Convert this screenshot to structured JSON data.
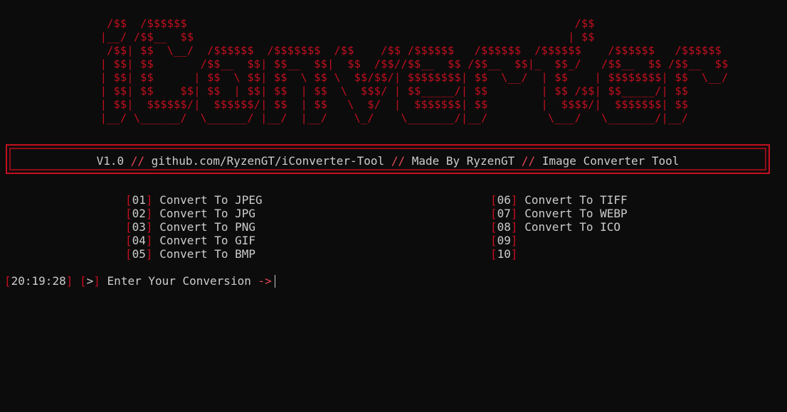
{
  "banner": {
    "lines": [
      "                /$$  /$$$$$$                                                          /$$",
      "               |__/ /$$__  $$                                                        | $$",
      "                /$$| $$  \\__/  /$$$$$$  /$$$$$$$  /$$    /$$ /$$$$$$   /$$$$$$  /$$$$$$    /$$$$$$   /$$$$$$",
      "               | $$| $$       /$$__  $$| $$__  $$|  $$  /$$//$$__  $$ /$$__  $$|_  $$_/   /$$__  $$ /$$__  $$",
      "               | $$| $$      | $$  \\ $$| $$  \\ $$ \\  $$/$$/| $$$$$$$$| $$  \\__/  | $$    | $$$$$$$$| $$  \\__/",
      "               | $$| $$    $$| $$  | $$| $$  | $$  \\  $$$/ | $$_____/| $$        | $$ /$$| $$_____/| $$",
      "               | $$|  $$$$$$/|  $$$$$$/| $$  | $$   \\  $/  |  $$$$$$$| $$        |  $$$$/|  $$$$$$$| $$",
      "               |__/ \\______/  \\______/ |__/  |__/    \\_/    \\_______/|__/         \\___/   \\_______/|__/"
    ]
  },
  "info": {
    "version": "V1.0",
    "sep": "//",
    "github": "github.com/RyzenGT/iConverter-Tool",
    "made_by": "Made By RyzenGT",
    "tool_name": "Image Converter Tool"
  },
  "menu": {
    "left": [
      {
        "num": "01",
        "label": "Convert To JPEG"
      },
      {
        "num": "02",
        "label": "Convert To JPG"
      },
      {
        "num": "03",
        "label": "Convert To PNG"
      },
      {
        "num": "04",
        "label": "Convert To GIF"
      },
      {
        "num": "05",
        "label": "Convert To BMP"
      }
    ],
    "right": [
      {
        "num": "06",
        "label": "Convert To TIFF"
      },
      {
        "num": "07",
        "label": "Convert To WEBP"
      },
      {
        "num": "08",
        "label": "Convert To ICO"
      },
      {
        "num": "09",
        "label": ""
      },
      {
        "num": "10",
        "label": ""
      }
    ]
  },
  "prompt": {
    "time": "20:19:28",
    "symbol": ">",
    "text": "Enter Your Conversion",
    "arrow": "->"
  },
  "colors": {
    "background": "#0c0c0c",
    "accent_red": "#c50f1f",
    "light_red": "#e74856",
    "text": "#cccccc"
  }
}
